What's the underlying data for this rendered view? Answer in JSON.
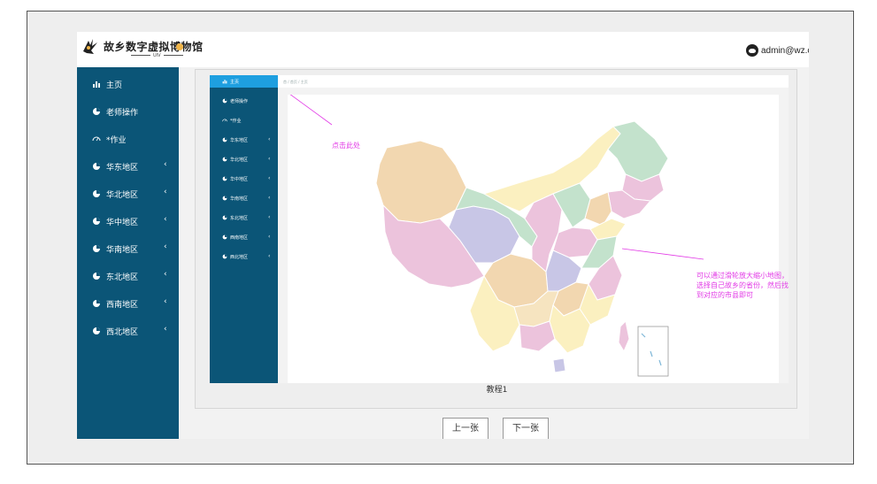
{
  "app": {
    "logo_title": "故乡数字虚拟博物馆",
    "logo_subtitle": "UIV",
    "user": "admin@wz.com"
  },
  "sidebar": {
    "items": [
      {
        "label": "主页",
        "icon": "bar-chart-icon",
        "chevron": ""
      },
      {
        "label": "老师操作",
        "icon": "pie-icon",
        "chevron": ""
      },
      {
        "label": "*作业",
        "icon": "gauge-icon",
        "chevron": ""
      },
      {
        "label": "华东地区",
        "icon": "pie-chart-icon",
        "chevron": "‹"
      },
      {
        "label": "华北地区",
        "icon": "pie-chart-icon",
        "chevron": "‹"
      },
      {
        "label": "华中地区",
        "icon": "pie-chart-icon",
        "chevron": "‹"
      },
      {
        "label": "华南地区",
        "icon": "pie-chart-icon",
        "chevron": "‹"
      },
      {
        "label": "东北地区",
        "icon": "pie-chart-icon",
        "chevron": "‹"
      },
      {
        "label": "西南地区",
        "icon": "pie-chart-icon",
        "chevron": "‹"
      },
      {
        "label": "西北地区",
        "icon": "pie-chart-icon",
        "chevron": "‹"
      }
    ]
  },
  "tutorial": {
    "inner_sidebar": [
      {
        "label": "主页",
        "icon": "bar-chart-icon",
        "chevron": ""
      },
      {
        "label": "老师操作",
        "icon": "pie-icon",
        "chevron": ""
      },
      {
        "label": "*作业",
        "icon": "gauge-icon",
        "chevron": ""
      },
      {
        "label": "华东地区",
        "icon": "pie-chart-icon",
        "chevron": "‹"
      },
      {
        "label": "华北地区",
        "icon": "pie-chart-icon",
        "chevron": "‹"
      },
      {
        "label": "华中地区",
        "icon": "pie-chart-icon",
        "chevron": "‹"
      },
      {
        "label": "华南地区",
        "icon": "pie-chart-icon",
        "chevron": "‹"
      },
      {
        "label": "东北地区",
        "icon": "pie-chart-icon",
        "chevron": "‹"
      },
      {
        "label": "西南地区",
        "icon": "pie-chart-icon",
        "chevron": "‹"
      },
      {
        "label": "西北地区",
        "icon": "pie-chart-icon",
        "chevron": "‹"
      }
    ],
    "inner_breadcrumb": "首 / 首页 / 主页",
    "annotation_click": "点击此处",
    "annotation_map": "可以通过滑轮放大缩小地图，选择自己故乡的省份，然后找到对应的市县即可",
    "caption": "教程1"
  },
  "pager": {
    "prev_label": "上一张",
    "next_label": "下一张"
  },
  "colors": {
    "sidebar_bg": "#0b5577",
    "active_nav": "#1e9fe0",
    "annotation": "#e23ae6",
    "logo_dot": "#f0b548"
  }
}
